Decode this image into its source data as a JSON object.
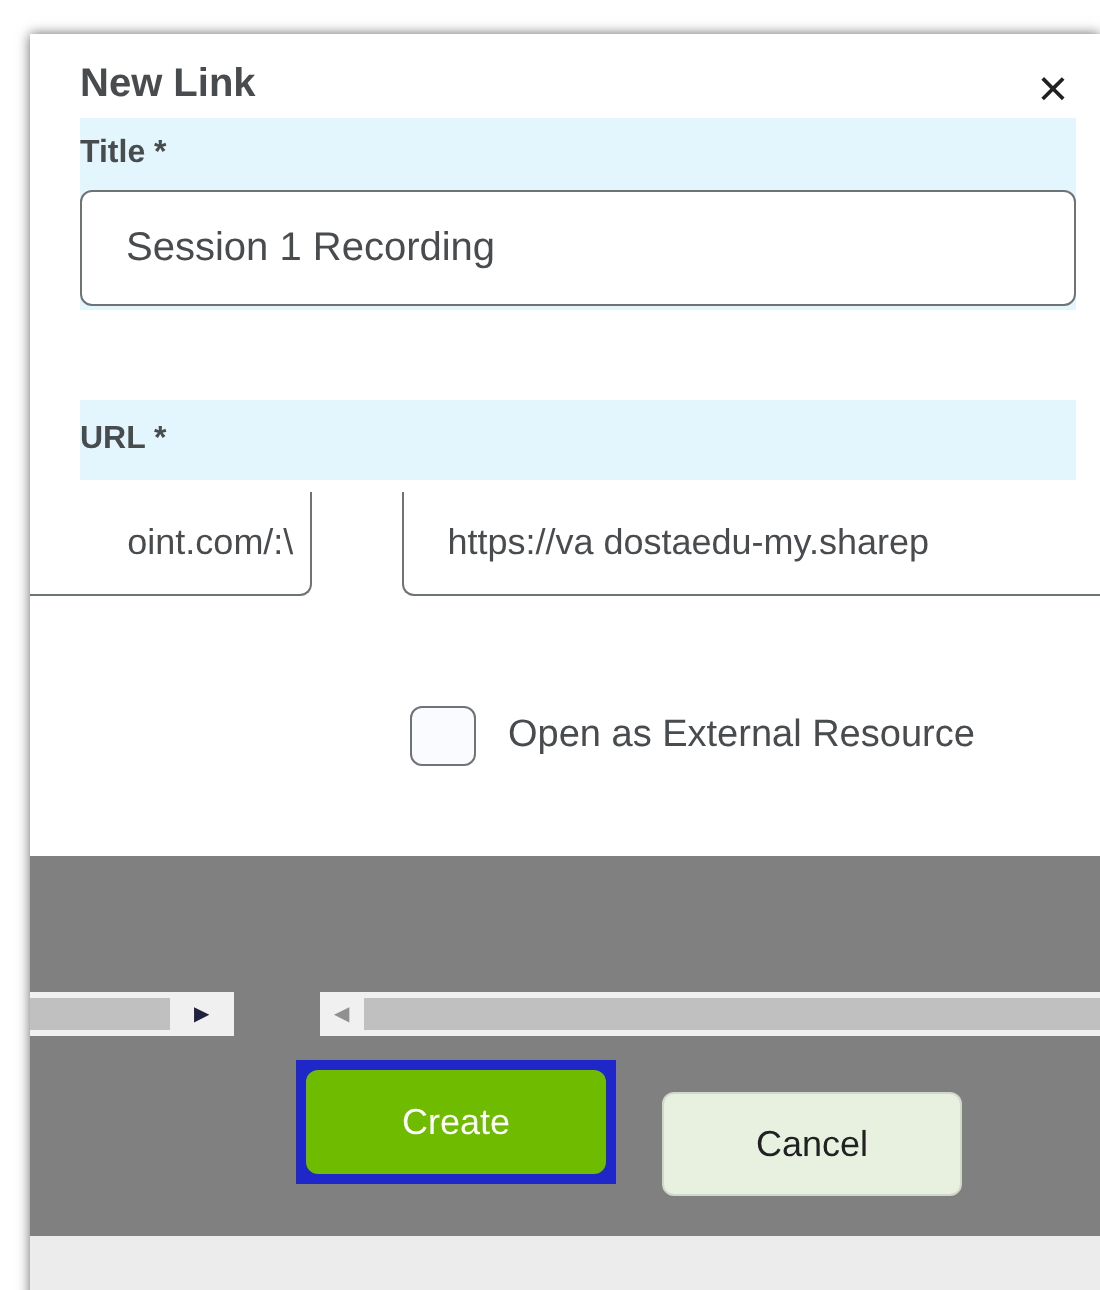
{
  "dialog": {
    "title": "New Link",
    "close": "×"
  },
  "fields": [
    {
      "label": "Title *",
      "value": "Session 1 Recording"
    },
    {
      "label": "URL *",
      "value_parts": [
        "oint.com/:\\",
        "https://va dostaedu-my.sharep"
      ]
    }
  ],
  "checkbox": {
    "label": "Open as External Resource",
    "checked": false
  },
  "scrollbars": {
    "right_arrow": "▶",
    "left_arrow": "◀"
  },
  "buttons": [
    {
      "label": "Create",
      "kind": "primary",
      "focused": true
    },
    {
      "label": "Cancel",
      "kind": "secondary",
      "focused": false
    }
  ]
}
